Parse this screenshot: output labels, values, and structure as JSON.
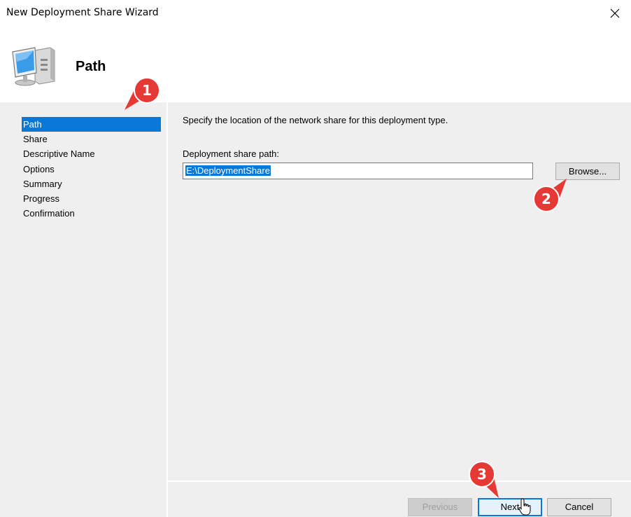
{
  "window": {
    "title": "New Deployment Share Wizard"
  },
  "header": {
    "page_title": "Path"
  },
  "steps": [
    {
      "label": "Path",
      "active": true
    },
    {
      "label": "Share"
    },
    {
      "label": "Descriptive Name"
    },
    {
      "label": "Options"
    },
    {
      "label": "Summary"
    },
    {
      "label": "Progress"
    },
    {
      "label": "Confirmation"
    }
  ],
  "main": {
    "instruction": "Specify the location of the network share for this deployment type.",
    "path_label": "Deployment share path:",
    "path_value": "E:\\DeploymentShare",
    "browse_label": "Browse..."
  },
  "footer": {
    "previous_label": "Previous",
    "next_label": "Next",
    "cancel_label": "Cancel"
  },
  "annotations": [
    {
      "number": "1"
    },
    {
      "number": "2"
    },
    {
      "number": "3"
    }
  ],
  "colors": {
    "selection": "#0a78d7",
    "marker": "#e53935",
    "panel_bg": "#efefef"
  }
}
